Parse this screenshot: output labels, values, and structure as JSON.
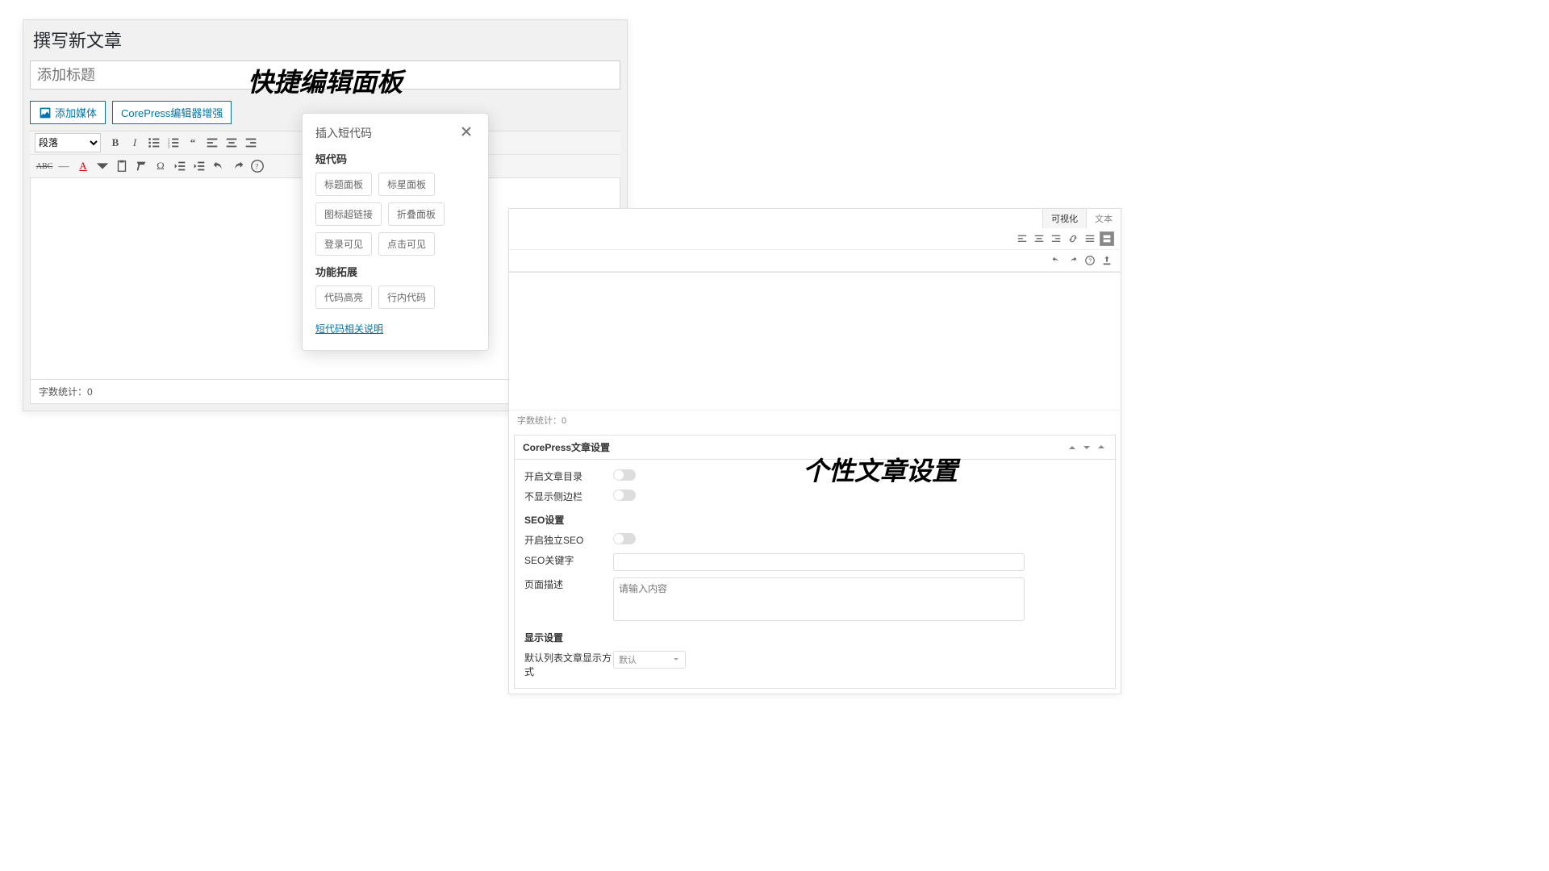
{
  "left": {
    "page_title": "撰写新文章",
    "title_placeholder": "添加标题",
    "overlay_heading": "快捷编辑面板",
    "buttons": {
      "add_media": "添加媒体",
      "corepress_enhance": "CorePress编辑器增强"
    },
    "format_select": "段落",
    "word_count": "字数统计：0"
  },
  "modal": {
    "title": "插入短代码",
    "section_shortcode": "短代码",
    "chips_shortcode": [
      "标题面板",
      "标星面板",
      "图标超链接",
      "折叠面板",
      "登录可见",
      "点击可见"
    ],
    "section_ext": "功能拓展",
    "chips_ext": [
      "代码高亮",
      "行内代码"
    ],
    "link": "短代码相关说明"
  },
  "right": {
    "tabs": {
      "visual": "可视化",
      "text": "文本"
    },
    "word_count": "字数统计：0",
    "overlay_heading": "个性文章设置",
    "settings_title": "CorePress文章设置",
    "toggles": {
      "enable_toc": "开启文章目录",
      "hide_sidebar": "不显示侧边栏",
      "enable_seo": "开启独立SEO"
    },
    "section_seo": "SEO设置",
    "seo_keywords_label": "SEO关键字",
    "page_desc_label": "页面描述",
    "page_desc_placeholder": "请输入内容",
    "section_display": "显示设置",
    "list_display_label": "默认列表文章显示方式",
    "list_display_value": "默认"
  }
}
